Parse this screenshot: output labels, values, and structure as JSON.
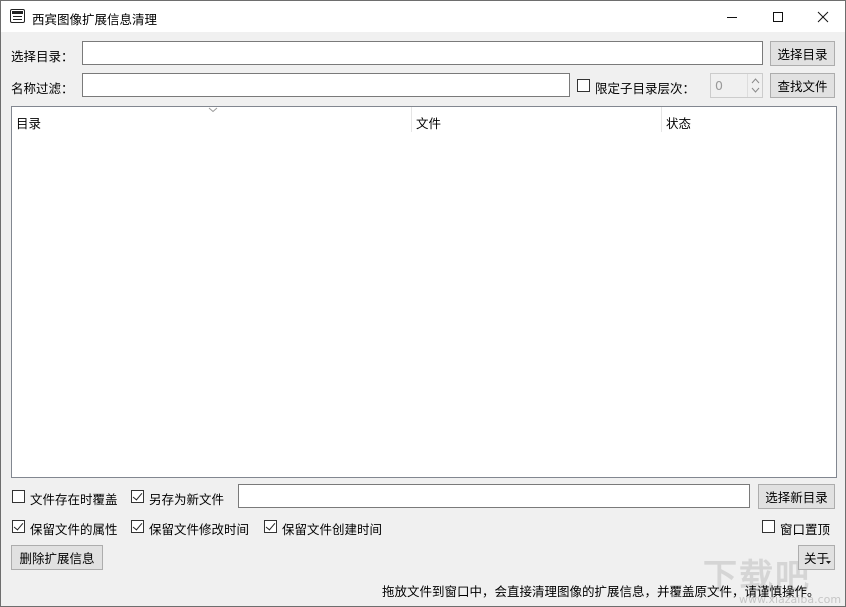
{
  "window": {
    "title": "西宾图像扩展信息清理"
  },
  "row1": {
    "label": "选择目录：",
    "value": "",
    "button": "选择目录"
  },
  "row2": {
    "label": "名称过滤：",
    "value": "",
    "limit_checkbox_label": "限定子目录层次：",
    "limit_checked": false,
    "depth_value": "0",
    "button": "查找文件"
  },
  "table": {
    "columns": [
      "目录",
      "文件",
      "状态"
    ],
    "rows": []
  },
  "options": {
    "overwrite_label": "文件存在时覆盖",
    "overwrite_checked": false,
    "saveas_label": "另存为新文件",
    "saveas_checked": true,
    "new_dir_value": "",
    "select_new_dir_button": "选择新目录",
    "keep_attr_label": "保留文件的属性",
    "keep_attr_checked": true,
    "keep_mtime_label": "保留文件修改时间",
    "keep_mtime_checked": true,
    "keep_ctime_label": "保留文件创建时间",
    "keep_ctime_checked": true,
    "topmost_label": "窗口置顶",
    "topmost_checked": false
  },
  "actions": {
    "delete_button": "删除扩展信息",
    "about_button": "关于"
  },
  "footer": {
    "message": "拖放文件到窗口中，会直接清理图像的扩展信息，并覆盖原文件，请谨慎操作。"
  },
  "watermark": {
    "text": "下载吧",
    "url": "www.xiazaiba.com"
  }
}
